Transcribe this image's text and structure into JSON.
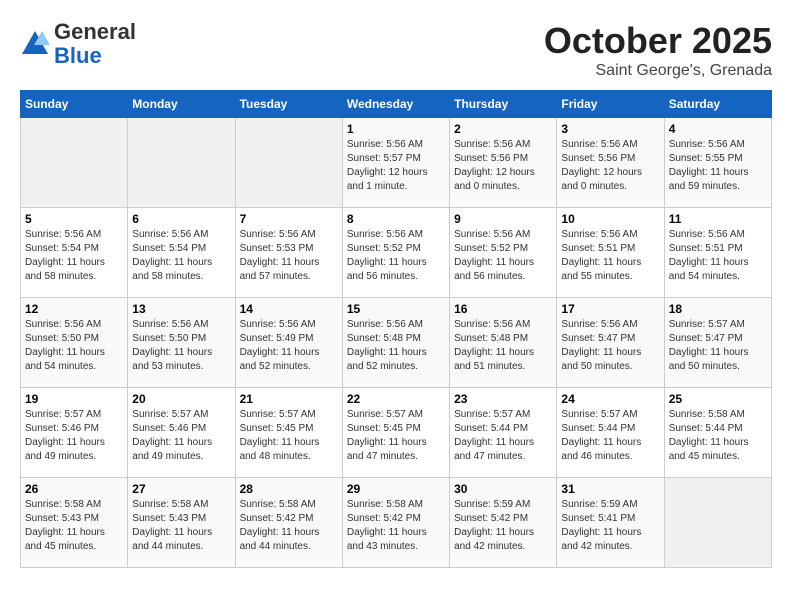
{
  "header": {
    "logo_general": "General",
    "logo_blue": "Blue",
    "month": "October 2025",
    "location": "Saint George's, Grenada"
  },
  "weekdays": [
    "Sunday",
    "Monday",
    "Tuesday",
    "Wednesday",
    "Thursday",
    "Friday",
    "Saturday"
  ],
  "weeks": [
    [
      {
        "day": "",
        "info": ""
      },
      {
        "day": "",
        "info": ""
      },
      {
        "day": "",
        "info": ""
      },
      {
        "day": "1",
        "info": "Sunrise: 5:56 AM\nSunset: 5:57 PM\nDaylight: 12 hours\nand 1 minute."
      },
      {
        "day": "2",
        "info": "Sunrise: 5:56 AM\nSunset: 5:56 PM\nDaylight: 12 hours\nand 0 minutes."
      },
      {
        "day": "3",
        "info": "Sunrise: 5:56 AM\nSunset: 5:56 PM\nDaylight: 12 hours\nand 0 minutes."
      },
      {
        "day": "4",
        "info": "Sunrise: 5:56 AM\nSunset: 5:55 PM\nDaylight: 11 hours\nand 59 minutes."
      }
    ],
    [
      {
        "day": "5",
        "info": "Sunrise: 5:56 AM\nSunset: 5:54 PM\nDaylight: 11 hours\nand 58 minutes."
      },
      {
        "day": "6",
        "info": "Sunrise: 5:56 AM\nSunset: 5:54 PM\nDaylight: 11 hours\nand 58 minutes."
      },
      {
        "day": "7",
        "info": "Sunrise: 5:56 AM\nSunset: 5:53 PM\nDaylight: 11 hours\nand 57 minutes."
      },
      {
        "day": "8",
        "info": "Sunrise: 5:56 AM\nSunset: 5:52 PM\nDaylight: 11 hours\nand 56 minutes."
      },
      {
        "day": "9",
        "info": "Sunrise: 5:56 AM\nSunset: 5:52 PM\nDaylight: 11 hours\nand 56 minutes."
      },
      {
        "day": "10",
        "info": "Sunrise: 5:56 AM\nSunset: 5:51 PM\nDaylight: 11 hours\nand 55 minutes."
      },
      {
        "day": "11",
        "info": "Sunrise: 5:56 AM\nSunset: 5:51 PM\nDaylight: 11 hours\nand 54 minutes."
      }
    ],
    [
      {
        "day": "12",
        "info": "Sunrise: 5:56 AM\nSunset: 5:50 PM\nDaylight: 11 hours\nand 54 minutes."
      },
      {
        "day": "13",
        "info": "Sunrise: 5:56 AM\nSunset: 5:50 PM\nDaylight: 11 hours\nand 53 minutes."
      },
      {
        "day": "14",
        "info": "Sunrise: 5:56 AM\nSunset: 5:49 PM\nDaylight: 11 hours\nand 52 minutes."
      },
      {
        "day": "15",
        "info": "Sunrise: 5:56 AM\nSunset: 5:48 PM\nDaylight: 11 hours\nand 52 minutes."
      },
      {
        "day": "16",
        "info": "Sunrise: 5:56 AM\nSunset: 5:48 PM\nDaylight: 11 hours\nand 51 minutes."
      },
      {
        "day": "17",
        "info": "Sunrise: 5:56 AM\nSunset: 5:47 PM\nDaylight: 11 hours\nand 50 minutes."
      },
      {
        "day": "18",
        "info": "Sunrise: 5:57 AM\nSunset: 5:47 PM\nDaylight: 11 hours\nand 50 minutes."
      }
    ],
    [
      {
        "day": "19",
        "info": "Sunrise: 5:57 AM\nSunset: 5:46 PM\nDaylight: 11 hours\nand 49 minutes."
      },
      {
        "day": "20",
        "info": "Sunrise: 5:57 AM\nSunset: 5:46 PM\nDaylight: 11 hours\nand 49 minutes."
      },
      {
        "day": "21",
        "info": "Sunrise: 5:57 AM\nSunset: 5:45 PM\nDaylight: 11 hours\nand 48 minutes."
      },
      {
        "day": "22",
        "info": "Sunrise: 5:57 AM\nSunset: 5:45 PM\nDaylight: 11 hours\nand 47 minutes."
      },
      {
        "day": "23",
        "info": "Sunrise: 5:57 AM\nSunset: 5:44 PM\nDaylight: 11 hours\nand 47 minutes."
      },
      {
        "day": "24",
        "info": "Sunrise: 5:57 AM\nSunset: 5:44 PM\nDaylight: 11 hours\nand 46 minutes."
      },
      {
        "day": "25",
        "info": "Sunrise: 5:58 AM\nSunset: 5:44 PM\nDaylight: 11 hours\nand 45 minutes."
      }
    ],
    [
      {
        "day": "26",
        "info": "Sunrise: 5:58 AM\nSunset: 5:43 PM\nDaylight: 11 hours\nand 45 minutes."
      },
      {
        "day": "27",
        "info": "Sunrise: 5:58 AM\nSunset: 5:43 PM\nDaylight: 11 hours\nand 44 minutes."
      },
      {
        "day": "28",
        "info": "Sunrise: 5:58 AM\nSunset: 5:42 PM\nDaylight: 11 hours\nand 44 minutes."
      },
      {
        "day": "29",
        "info": "Sunrise: 5:58 AM\nSunset: 5:42 PM\nDaylight: 11 hours\nand 43 minutes."
      },
      {
        "day": "30",
        "info": "Sunrise: 5:59 AM\nSunset: 5:42 PM\nDaylight: 11 hours\nand 42 minutes."
      },
      {
        "day": "31",
        "info": "Sunrise: 5:59 AM\nSunset: 5:41 PM\nDaylight: 11 hours\nand 42 minutes."
      },
      {
        "day": "",
        "info": ""
      }
    ]
  ]
}
